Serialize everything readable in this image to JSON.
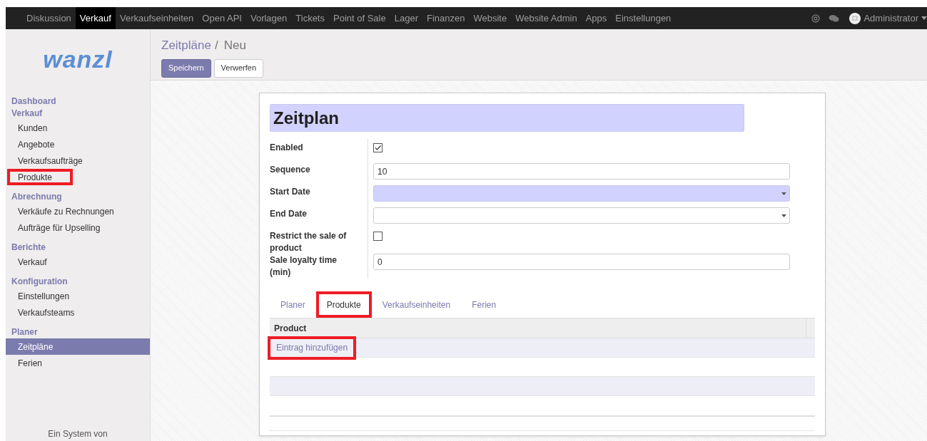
{
  "top_menu": [
    {
      "label": "Diskussion",
      "selected": false
    },
    {
      "label": "Verkauf",
      "selected": true
    },
    {
      "label": "Verkaufseinheiten",
      "selected": false
    },
    {
      "label": "Open API",
      "selected": false
    },
    {
      "label": "Vorlagen",
      "selected": false
    },
    {
      "label": "Tickets",
      "selected": false
    },
    {
      "label": "Point of Sale",
      "selected": false
    },
    {
      "label": "Lager",
      "selected": false
    },
    {
      "label": "Finanzen",
      "selected": false
    },
    {
      "label": "Website",
      "selected": false
    },
    {
      "label": "Website Admin",
      "selected": false
    },
    {
      "label": "Apps",
      "selected": false
    },
    {
      "label": "Einstellungen",
      "selected": false
    }
  ],
  "user": {
    "name": "Administrator"
  },
  "logo": {
    "text": "wanzl"
  },
  "sidebar": {
    "sections": [
      {
        "title": "Dashboard"
      },
      {
        "title": "Verkauf",
        "items": [
          {
            "label": "Kunden",
            "selected": false,
            "highlighted": false
          },
          {
            "label": "Angebote",
            "selected": false,
            "highlighted": false
          },
          {
            "label": "Verkaufsaufträge",
            "selected": false,
            "highlighted": false
          },
          {
            "label": "Produkte",
            "selected": false,
            "highlighted": true
          }
        ]
      },
      {
        "title": "Abrechnung",
        "items": [
          {
            "label": "Verkäufe zu Rechnungen",
            "selected": false,
            "highlighted": false
          },
          {
            "label": "Aufträge für Upselling",
            "selected": false,
            "highlighted": false
          }
        ]
      },
      {
        "title": "Berichte",
        "items": [
          {
            "label": "Verkauf",
            "selected": false,
            "highlighted": false
          }
        ]
      },
      {
        "title": "Konfiguration",
        "items": [
          {
            "label": "Einstellungen",
            "selected": false,
            "highlighted": false
          },
          {
            "label": "Verkaufsteams",
            "selected": false,
            "highlighted": false
          }
        ]
      },
      {
        "title": "Planer",
        "items": [
          {
            "label": "Zeitpläne",
            "selected": true,
            "highlighted": false
          },
          {
            "label": "Ferien",
            "selected": false,
            "highlighted": false
          }
        ]
      }
    ],
    "footer": "Ein System von"
  },
  "breadcrumb": {
    "parent": "Zeitpläne",
    "separator": "/",
    "current": "Neu"
  },
  "buttons": [
    {
      "label": "Speichern",
      "kind": "primary"
    },
    {
      "label": "Verwerfen",
      "kind": "secondary"
    }
  ],
  "form": {
    "title": "Zeitplan",
    "fields": [
      {
        "label": "Enabled",
        "kind": "checkbox",
        "checked": true
      },
      {
        "label": "Sequence",
        "kind": "text",
        "value": "10"
      },
      {
        "label": "Start Date",
        "kind": "select",
        "required": true
      },
      {
        "label": "End Date",
        "kind": "select",
        "required": false
      },
      {
        "label": "Restrict the sale of product",
        "kind": "checkbox",
        "checked": false
      },
      {
        "label": "Sale loyalty time (min)",
        "kind": "text",
        "value": "0"
      }
    ],
    "tabs": [
      {
        "label": "Planer",
        "selected": false,
        "highlighted": false
      },
      {
        "label": "Produkte",
        "selected": true,
        "highlighted": true
      },
      {
        "label": "Verkaufseinheiten",
        "selected": false,
        "highlighted": false
      },
      {
        "label": "Ferien",
        "selected": false,
        "highlighted": false
      }
    ],
    "table": {
      "columns": [
        "Product"
      ],
      "add_link": {
        "label": "Eintrag hinzufügen",
        "highlighted": true
      }
    }
  }
}
